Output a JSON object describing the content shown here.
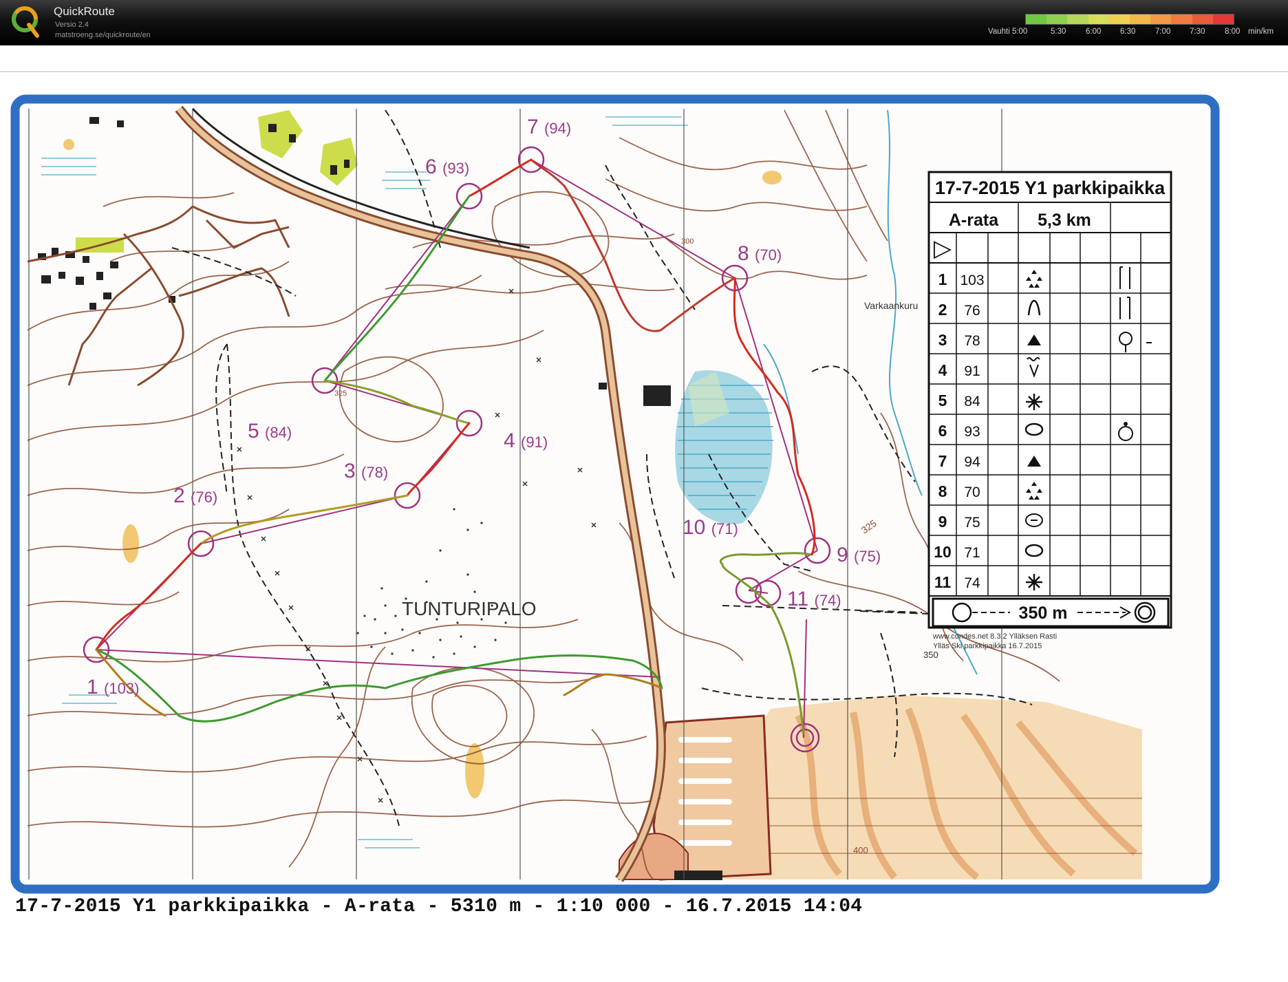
{
  "app": {
    "name": "QuickRoute",
    "version": "Versio 2.4",
    "url": "matstroeng.se/quickroute/en"
  },
  "pace_legend": {
    "label": "Vauhti 5:00",
    "ticks": [
      "5:30",
      "6:00",
      "6:30",
      "7:00",
      "7:30",
      "8:00"
    ],
    "unit": "min/km",
    "colors": [
      "#6ec840",
      "#8fd050",
      "#b5d85a",
      "#d8dc5a",
      "#f0d050",
      "#f4b848",
      "#f49a44",
      "#f07a40",
      "#ec5a3c",
      "#e43838"
    ]
  },
  "map": {
    "place_name": "TUNTURIPALO",
    "stream_name": "Varkaankuru",
    "spot_heights": [
      "325",
      "325",
      "350",
      "400",
      "300"
    ],
    "credits": [
      "www.condes.net 8.3.2 Ylläksen Rasti",
      "Ylläs Ski parkkipaikka 16.7.2015"
    ],
    "controls": [
      {
        "label": "1",
        "code": "(103)"
      },
      {
        "label": "2",
        "code": "(76)"
      },
      {
        "label": "3",
        "code": "(78)"
      },
      {
        "label": "4",
        "code": "(91)"
      },
      {
        "label": "5",
        "code": "(84)"
      },
      {
        "label": "6",
        "code": "(93)"
      },
      {
        "label": "7",
        "code": "(94)"
      },
      {
        "label": "8",
        "code": "(70)"
      },
      {
        "label": "9",
        "code": "(75)"
      },
      {
        "label": "10",
        "code": "(71)"
      },
      {
        "label": "11",
        "code": "(74)"
      }
    ],
    "colors": {
      "border": "#2e6fc4",
      "course": "#a0307f",
      "route_red": "#d42a1e",
      "route_green": "#3c9a2e",
      "contour": "#8a4a2e",
      "water": "#4aa8c8"
    }
  },
  "description_sheet": {
    "title": "17-7-2015 Y1 parkkipaikka",
    "course": "A-rata",
    "length": "5,3 km",
    "start_symbol": "▷",
    "rows": [
      {
        "num": "1",
        "code": "103"
      },
      {
        "num": "2",
        "code": "76"
      },
      {
        "num": "3",
        "code": "78"
      },
      {
        "num": "4",
        "code": "91"
      },
      {
        "num": "5",
        "code": "84"
      },
      {
        "num": "6",
        "code": "93"
      },
      {
        "num": "7",
        "code": "94"
      },
      {
        "num": "8",
        "code": "70"
      },
      {
        "num": "9",
        "code": "75"
      },
      {
        "num": "10",
        "code": "71"
      },
      {
        "num": "11",
        "code": "74"
      }
    ],
    "finish": "350 m"
  },
  "caption": "17-7-2015 Y1 parkkipaikka - A-rata - 5310 m - 1:10 000 - 16.7.2015 14:04"
}
